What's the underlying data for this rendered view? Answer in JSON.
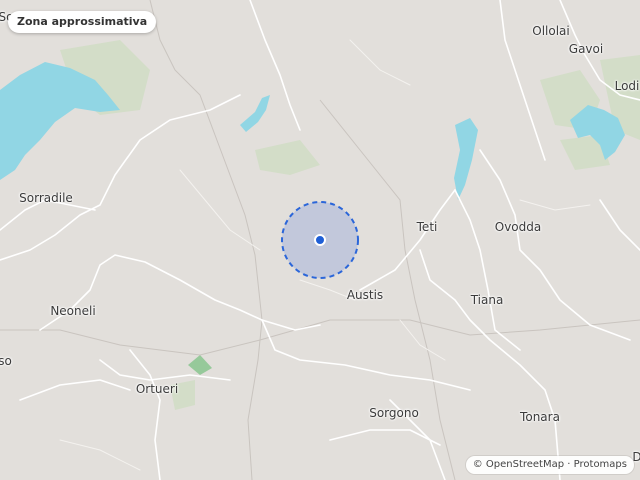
{
  "badge": {
    "label": "Zona approssimativa"
  },
  "places": [
    {
      "key": "sorradile",
      "label": "Sorradile"
    },
    {
      "key": "neoneli",
      "label": "Neoneli"
    },
    {
      "key": "ortueri",
      "label": "Ortueri"
    },
    {
      "key": "sorgono",
      "label": "Sorgono"
    },
    {
      "key": "austis",
      "label": "Austis"
    },
    {
      "key": "teti",
      "label": "Teti"
    },
    {
      "key": "ovodda",
      "label": "Ovodda"
    },
    {
      "key": "tiana",
      "label": "Tiana"
    },
    {
      "key": "tonara",
      "label": "Tonara"
    },
    {
      "key": "ollolai",
      "label": "Ollolai"
    },
    {
      "key": "gavoi",
      "label": "Gavoi"
    },
    {
      "key": "lodine",
      "label": "Lodi"
    },
    {
      "key": "so-top",
      "label": "So"
    },
    {
      "key": "so-left",
      "label": "so"
    },
    {
      "key": "d-edge",
      "label": "D"
    }
  ],
  "attribution": {
    "osm": "© OpenStreetMap",
    "sep": "·",
    "provider": "Protomaps"
  },
  "colors": {
    "land": "#e2dfdb",
    "water": "#8fd8e6",
    "park": "#cfdcc4",
    "road": "#ffffff",
    "accuracy": "#2b66d9",
    "marker": "#1f5fd6"
  }
}
